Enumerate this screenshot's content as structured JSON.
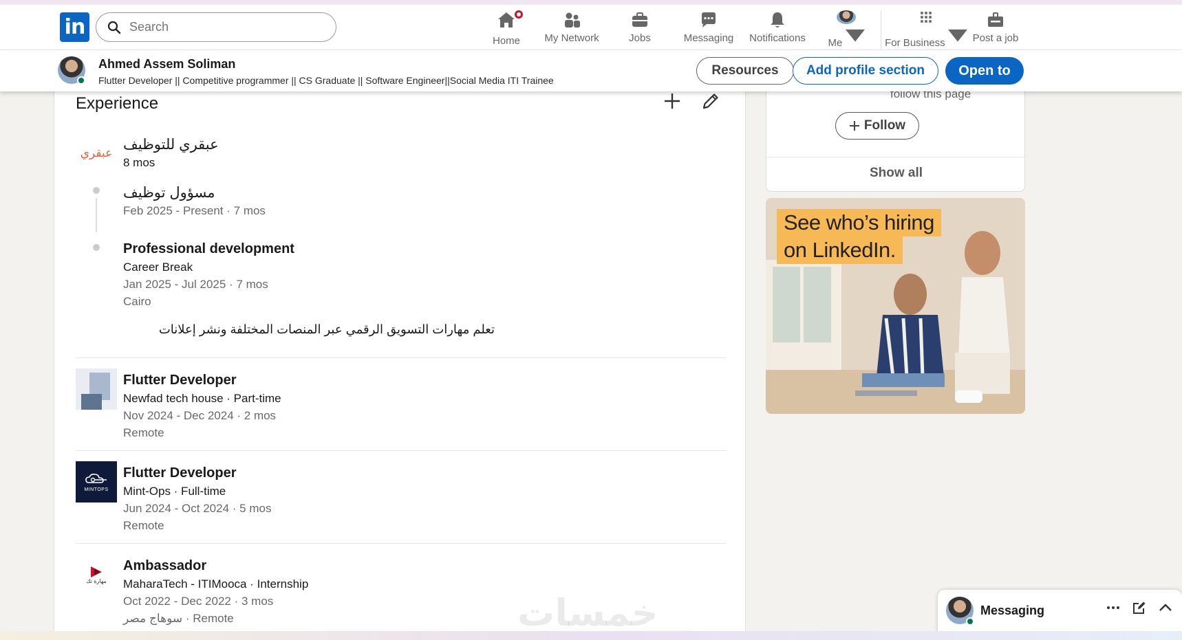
{
  "nav": {
    "logo_text": "in",
    "search_placeholder": "Search",
    "items": [
      {
        "label": "Home",
        "icon": "home-icon"
      },
      {
        "label": "My Network",
        "icon": "network-icon"
      },
      {
        "label": "Jobs",
        "icon": "briefcase-icon"
      },
      {
        "label": "Messaging",
        "icon": "chat-icon"
      },
      {
        "label": "Notifications",
        "icon": "bell-icon"
      },
      {
        "label": "Me",
        "icon": "avatar"
      },
      {
        "label": "For Business",
        "icon": "grid-icon"
      },
      {
        "label": "Post a job",
        "icon": "post-job-icon"
      }
    ],
    "accent": "#0a66c2",
    "badge_color": "#cb112d"
  },
  "profile_bar": {
    "name": "Ahmed Assem Soliman",
    "headline": "Flutter Developer || Competitive programmer || CS Graduate || Software Engineer||Social Media ITI Trainee",
    "resources_label": "Resources",
    "add_section_label": "Add profile section",
    "open_to_label": "Open to"
  },
  "experience": {
    "title": "Experience",
    "company_group": {
      "company": "عبقري للتوظيف",
      "logo_text": "عبقري",
      "duration": "8 mos",
      "roles": [
        {
          "title": "مسؤول توظيف",
          "dates": "Feb 2025 - Present · 7 mos"
        },
        {
          "title": "Professional development",
          "subtitle": "Career Break",
          "dates": "Jan 2025 - Jul 2025 · 7 mos",
          "location": "Cairo",
          "description": "تعلم مهارات التسويق الرقمي عبر المنصات المختلفة ونشر إعلانات"
        }
      ]
    },
    "entries": [
      {
        "title": "Flutter Developer",
        "company": "Newfad tech house · Part-time",
        "dates": "Nov 2024 - Dec 2024 · 2 mos",
        "location": "Remote"
      },
      {
        "title": "Flutter Developer",
        "company": "Mint-Ops · Full-time",
        "dates": "Jun 2024 - Oct 2024 · 5 mos",
        "location": "Remote",
        "logo_text": "MINTOPS"
      },
      {
        "title": "Ambassador",
        "company": "MaharaTech - ITIMooca · Internship",
        "dates": "Oct 2022 - Dec 2022 · 3 mos",
        "location": "سوهاج مصر · Remote",
        "logo_text": "مهارة تك"
      }
    ]
  },
  "follow_card": {
    "note": "follow this page",
    "follow_label": "Follow",
    "show_all_label": "Show all"
  },
  "ad": {
    "line1": "See who’s hiring",
    "line2": "on LinkedIn."
  },
  "messaging": {
    "label": "Messaging"
  },
  "watermark": "خمسات"
}
